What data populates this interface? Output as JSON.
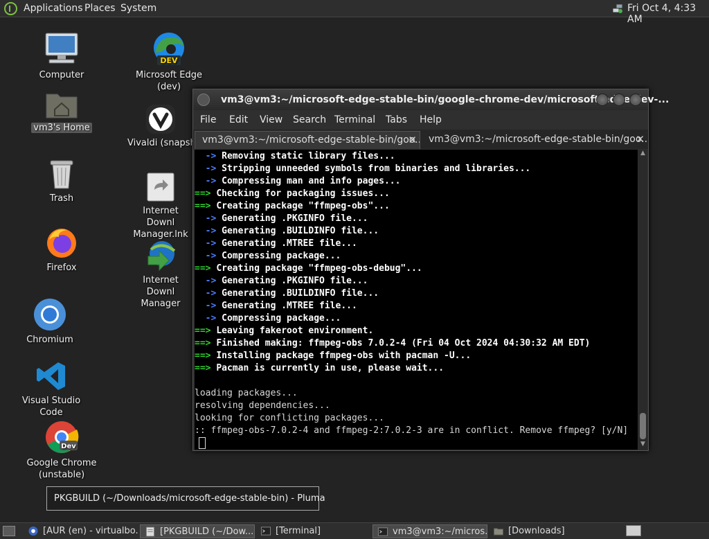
{
  "top_panel": {
    "menus": [
      "Applications",
      "Places",
      "System"
    ],
    "clock": "Fri Oct  4,  4:33 AM"
  },
  "desktop": {
    "icons": [
      {
        "label": "Computer",
        "icon": "computer-icon"
      },
      {
        "label": "vm3's Home",
        "icon": "home-folder-icon"
      },
      {
        "label": "Trash",
        "icon": "trash-icon"
      },
      {
        "label": "Firefox",
        "icon": "firefox-icon"
      },
      {
        "label": "Chromium",
        "icon": "chromium-icon"
      },
      {
        "label": "Visual Studio Code",
        "icon": "vscode-icon"
      },
      {
        "label": "Google Chrome (unstable)",
        "icon": "chrome-dev-icon"
      },
      {
        "label": "Microsoft Edge (dev)",
        "icon": "edge-dev-icon"
      },
      {
        "label": "Vivaldi (snapsh",
        "icon": "vivaldi-icon"
      },
      {
        "label": "Internet Downl Manager.lnk",
        "icon": "link-file-icon"
      },
      {
        "label": "Internet Downl Manager",
        "icon": "idm-icon"
      }
    ],
    "edge_badge": "DEV",
    "chrome_badge": "Dev"
  },
  "terminal": {
    "title": "vm3@vm3:~/microsoft-edge-stable-bin/google-chrome-dev/microsoft-edge-dev-...",
    "menu": [
      "File",
      "Edit",
      "View",
      "Search",
      "Terminal",
      "Tabs",
      "Help"
    ],
    "tabs": [
      {
        "label": "vm3@vm3:~/microsoft-edge-stable-bin/goo..."
      },
      {
        "label": "vm3@vm3:~/microsoft-edge-stable-bin/goo..."
      }
    ],
    "lines": [
      {
        "prefix": "  -> ",
        "text": "Removing static library files..."
      },
      {
        "prefix": "  -> ",
        "text": "Stripping unneeded symbols from binaries and libraries..."
      },
      {
        "prefix": "  -> ",
        "text": "Compressing man and info pages..."
      },
      {
        "prefix": "==> ",
        "text": "Checking for packaging issues..."
      },
      {
        "prefix": "==> ",
        "text": "Creating package \"ffmpeg-obs\"..."
      },
      {
        "prefix": "  -> ",
        "text": "Generating .PKGINFO file..."
      },
      {
        "prefix": "  -> ",
        "text": "Generating .BUILDINFO file..."
      },
      {
        "prefix": "  -> ",
        "text": "Generating .MTREE file..."
      },
      {
        "prefix": "  -> ",
        "text": "Compressing package..."
      },
      {
        "prefix": "==> ",
        "text": "Creating package \"ffmpeg-obs-debug\"..."
      },
      {
        "prefix": "  -> ",
        "text": "Generating .PKGINFO file..."
      },
      {
        "prefix": "  -> ",
        "text": "Generating .BUILDINFO file..."
      },
      {
        "prefix": "  -> ",
        "text": "Generating .MTREE file..."
      },
      {
        "prefix": "  -> ",
        "text": "Compressing package..."
      },
      {
        "prefix": "==> ",
        "text": "Leaving fakeroot environment."
      },
      {
        "prefix": "==> ",
        "text": "Finished making: ffmpeg-obs 7.0.2-4 (Fri 04 Oct 2024 04:30:32 AM EDT)"
      },
      {
        "prefix": "==> ",
        "text": "Installing package ffmpeg-obs with pacman -U..."
      },
      {
        "prefix": "==> ",
        "text": "Pacman is currently in use, please wait..."
      },
      {
        "prefix": "",
        "text": ""
      },
      {
        "prefix": "",
        "text": "loading packages..."
      },
      {
        "prefix": "",
        "text": "resolving dependencies..."
      },
      {
        "prefix": "",
        "text": "looking for conflicting packages..."
      },
      {
        "prefix": "",
        "text": ":: ffmpeg-obs-7.0.2-4 and ffmpeg-2:7.0.2-3 are in conflict. Remove ffmpeg? [y/N]"
      }
    ]
  },
  "tooltip": "PKGBUILD (~/Downloads/microsoft-edge-stable-bin) - Pluma",
  "taskbar": {
    "items": [
      {
        "label": "[AUR (en) - virtualbo...",
        "icon": "browser-icon"
      },
      {
        "label": "[PKGBUILD (~/Dow...",
        "icon": "text-editor-icon"
      },
      {
        "label": "[Terminal]",
        "icon": "terminal-icon"
      },
      {
        "label": "vm3@vm3:~/micros...",
        "icon": "terminal-icon"
      },
      {
        "label": "[Downloads]",
        "icon": "folder-icon"
      }
    ]
  },
  "colors": {
    "prompt_green": "#2fd32f",
    "arrow_blue": "#4b7bff"
  }
}
